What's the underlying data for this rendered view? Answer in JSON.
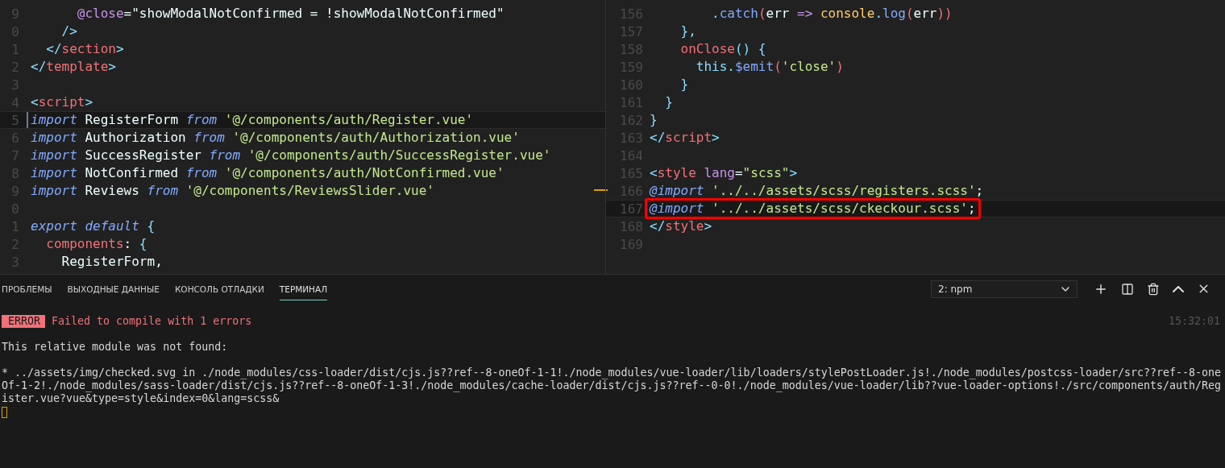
{
  "editors": [
    {
      "lines": [
        {
          "num": "9",
          "tokens": [
            {
              "t": "      @close",
              "kind": "attr"
            },
            {
              "t": "=",
              "kind": "plain"
            },
            {
              "t": "\"showModalNotConfirmed = !showModalNotConfirmed\"",
              "kind": "attrval"
            }
          ]
        },
        {
          "num": "0",
          "tokens": [
            {
              "t": "    />",
              "kind": "punct"
            }
          ]
        },
        {
          "num": "1",
          "tokens": [
            {
              "t": "  </",
              "kind": "punct"
            },
            {
              "t": "section",
              "kind": "tag"
            },
            {
              "t": ">",
              "kind": "punct"
            }
          ]
        },
        {
          "num": "2",
          "tokens": [
            {
              "t": "</",
              "kind": "punct"
            },
            {
              "t": "template",
              "kind": "tag"
            },
            {
              "t": ">",
              "kind": "punct"
            }
          ]
        },
        {
          "num": "3"
        },
        {
          "num": "4",
          "tokens": [
            {
              "t": "<",
              "kind": "punct"
            },
            {
              "t": "script",
              "kind": "tag"
            },
            {
              "t": ">",
              "kind": "punct"
            }
          ]
        },
        {
          "num": "5",
          "current": true,
          "tokens": [
            {
              "t": "import",
              "kind": "keyword"
            },
            {
              "t": " RegisterForm ",
              "kind": "plain"
            },
            {
              "t": "from ",
              "kind": "keyword"
            },
            {
              "t": "'@/components/auth/Register.vue'",
              "kind": "string"
            }
          ]
        },
        {
          "num": "6",
          "tokens": [
            {
              "t": "import",
              "kind": "keyword"
            },
            {
              "t": " Authorization ",
              "kind": "plain"
            },
            {
              "t": "from ",
              "kind": "keyword"
            },
            {
              "t": "'@/components/auth/Authorization.vue'",
              "kind": "string"
            }
          ]
        },
        {
          "num": "7",
          "tokens": [
            {
              "t": "import",
              "kind": "keyword"
            },
            {
              "t": " SuccessRegister ",
              "kind": "plain"
            },
            {
              "t": "from ",
              "kind": "keyword"
            },
            {
              "t": "'@/components/auth/SuccessRegister.vue'",
              "kind": "string"
            }
          ]
        },
        {
          "num": "8",
          "tokens": [
            {
              "t": "import",
              "kind": "keyword"
            },
            {
              "t": " NotConfirmed ",
              "kind": "plain"
            },
            {
              "t": "from ",
              "kind": "keyword"
            },
            {
              "t": "'@/components/auth/NotConfirmed.vue'",
              "kind": "string"
            }
          ]
        },
        {
          "num": "9",
          "ruler_mark": true,
          "tokens": [
            {
              "t": "import",
              "kind": "keyword"
            },
            {
              "t": " Reviews ",
              "kind": "plain"
            },
            {
              "t": "from ",
              "kind": "keyword"
            },
            {
              "t": "'@/components/ReviewsSlider.vue'",
              "kind": "string"
            }
          ]
        },
        {
          "num": "0"
        },
        {
          "num": "1",
          "tokens": [
            {
              "t": "export default ",
              "kind": "keyword"
            },
            {
              "t": "{",
              "kind": "punct"
            }
          ]
        },
        {
          "num": "2",
          "tokens": [
            {
              "t": "  components",
              "kind": "tag"
            },
            {
              "t": ": ",
              "kind": "plain"
            },
            {
              "t": "{",
              "kind": "punct"
            }
          ]
        },
        {
          "num": "3",
          "tokens": [
            {
              "t": "    RegisterForm,",
              "kind": "plain"
            }
          ]
        }
      ]
    },
    {
      "lines": [
        {
          "num": "156",
          "tokens": [
            {
              "t": "        .",
              "kind": "punct"
            },
            {
              "t": "catch",
              "kind": "func"
            },
            {
              "t": "(",
              "kind": "paren"
            },
            {
              "t": "err ",
              "kind": "plain"
            },
            {
              "t": "=> ",
              "kind": "attr"
            },
            {
              "t": "console",
              "kind": "object"
            },
            {
              "t": ".",
              "kind": "punct"
            },
            {
              "t": "log",
              "kind": "func"
            },
            {
              "t": "(",
              "kind": "paren"
            },
            {
              "t": "err",
              "kind": "plain"
            },
            {
              "t": "))",
              "kind": "paren"
            }
          ]
        },
        {
          "num": "157",
          "tokens": [
            {
              "t": "    },",
              "kind": "punct"
            }
          ]
        },
        {
          "num": "158",
          "tokens": [
            {
              "t": "    onClose",
              "kind": "tag"
            },
            {
              "t": "() {",
              "kind": "punct"
            }
          ]
        },
        {
          "num": "159",
          "tokens": [
            {
              "t": "      this.",
              "kind": "punct"
            },
            {
              "t": "$emit",
              "kind": "func"
            },
            {
              "t": "(",
              "kind": "paren"
            },
            {
              "t": "'close'",
              "kind": "string"
            },
            {
              "t": ")",
              "kind": "paren"
            }
          ]
        },
        {
          "num": "160",
          "tokens": [
            {
              "t": "    }",
              "kind": "punct"
            }
          ]
        },
        {
          "num": "161",
          "tokens": [
            {
              "t": "  }",
              "kind": "punct"
            }
          ]
        },
        {
          "num": "162",
          "tokens": [
            {
              "t": "}",
              "kind": "punct"
            }
          ]
        },
        {
          "num": "163",
          "tokens": [
            {
              "t": "</",
              "kind": "punct"
            },
            {
              "t": "script",
              "kind": "tag"
            },
            {
              "t": ">",
              "kind": "punct"
            }
          ]
        },
        {
          "num": "164"
        },
        {
          "num": "165",
          "tokens": [
            {
              "t": "<",
              "kind": "punct"
            },
            {
              "t": "style ",
              "kind": "tag"
            },
            {
              "t": "lang",
              "kind": "attr"
            },
            {
              "t": "=",
              "kind": "plain"
            },
            {
              "t": "\"scss\"",
              "kind": "string"
            },
            {
              "t": ">",
              "kind": "punct"
            }
          ]
        },
        {
          "num": "166",
          "ruler_mark": true,
          "tokens": [
            {
              "t": "@import ",
              "kind": "keyword"
            },
            {
              "t": "'../../assets/scss/registers.scss'",
              "kind": "string"
            },
            {
              "t": ";",
              "kind": "plain"
            }
          ]
        },
        {
          "num": "167",
          "current": true,
          "boxed": true,
          "tokens": [
            {
              "t": "@import ",
              "kind": "keyword"
            },
            {
              "t": "'../../assets/scss/ckeckour.scss'",
              "kind": "string"
            },
            {
              "t": ";",
              "kind": "plain"
            }
          ]
        },
        {
          "num": "168",
          "tokens": [
            {
              "t": "</",
              "kind": "punct"
            },
            {
              "t": "style",
              "kind": "tag"
            },
            {
              "t": ">",
              "kind": "punct"
            }
          ]
        },
        {
          "num": "169"
        }
      ]
    }
  ],
  "panel": {
    "tabs": [
      {
        "label": "ПРОБЛЕМЫ",
        "selected": false
      },
      {
        "label": "ВЫХОДНЫЕ ДАННЫЕ",
        "selected": false
      },
      {
        "label": "КОНСОЛЬ ОТЛАДКИ",
        "selected": false
      },
      {
        "label": "ТЕРМИНАЛ",
        "selected": true
      }
    ],
    "terminal_select": "2: npm",
    "terminal": [
      {
        "kind": "error",
        "badge": "ERROR",
        "text": "Failed to compile with 1 errors",
        "time": "15:32:01"
      },
      {
        "kind": "blank"
      },
      {
        "kind": "text",
        "text": "This relative module was not found:"
      },
      {
        "kind": "blank"
      },
      {
        "kind": "text",
        "text": "* ../assets/img/checked.svg in ./node_modules/css-loader/dist/cjs.js??ref--8-oneOf-1-1!./node_modules/vue-loader/lib/loaders/stylePostLoader.js!./node_modules/postcss-loader/src??ref--8-one"
      },
      {
        "kind": "text",
        "text": "Of-1-2!./node_modules/sass-loader/dist/cjs.js??ref--8-oneOf-1-3!./node_modules/cache-loader/dist/cjs.js??ref--0-0!./node_modules/vue-loader/lib??vue-loader-options!./src/components/auth/Reg"
      },
      {
        "kind": "text",
        "text": "ister.vue?vue&type=style&index=0&lang=scss&"
      },
      {
        "kind": "cursor"
      }
    ]
  }
}
